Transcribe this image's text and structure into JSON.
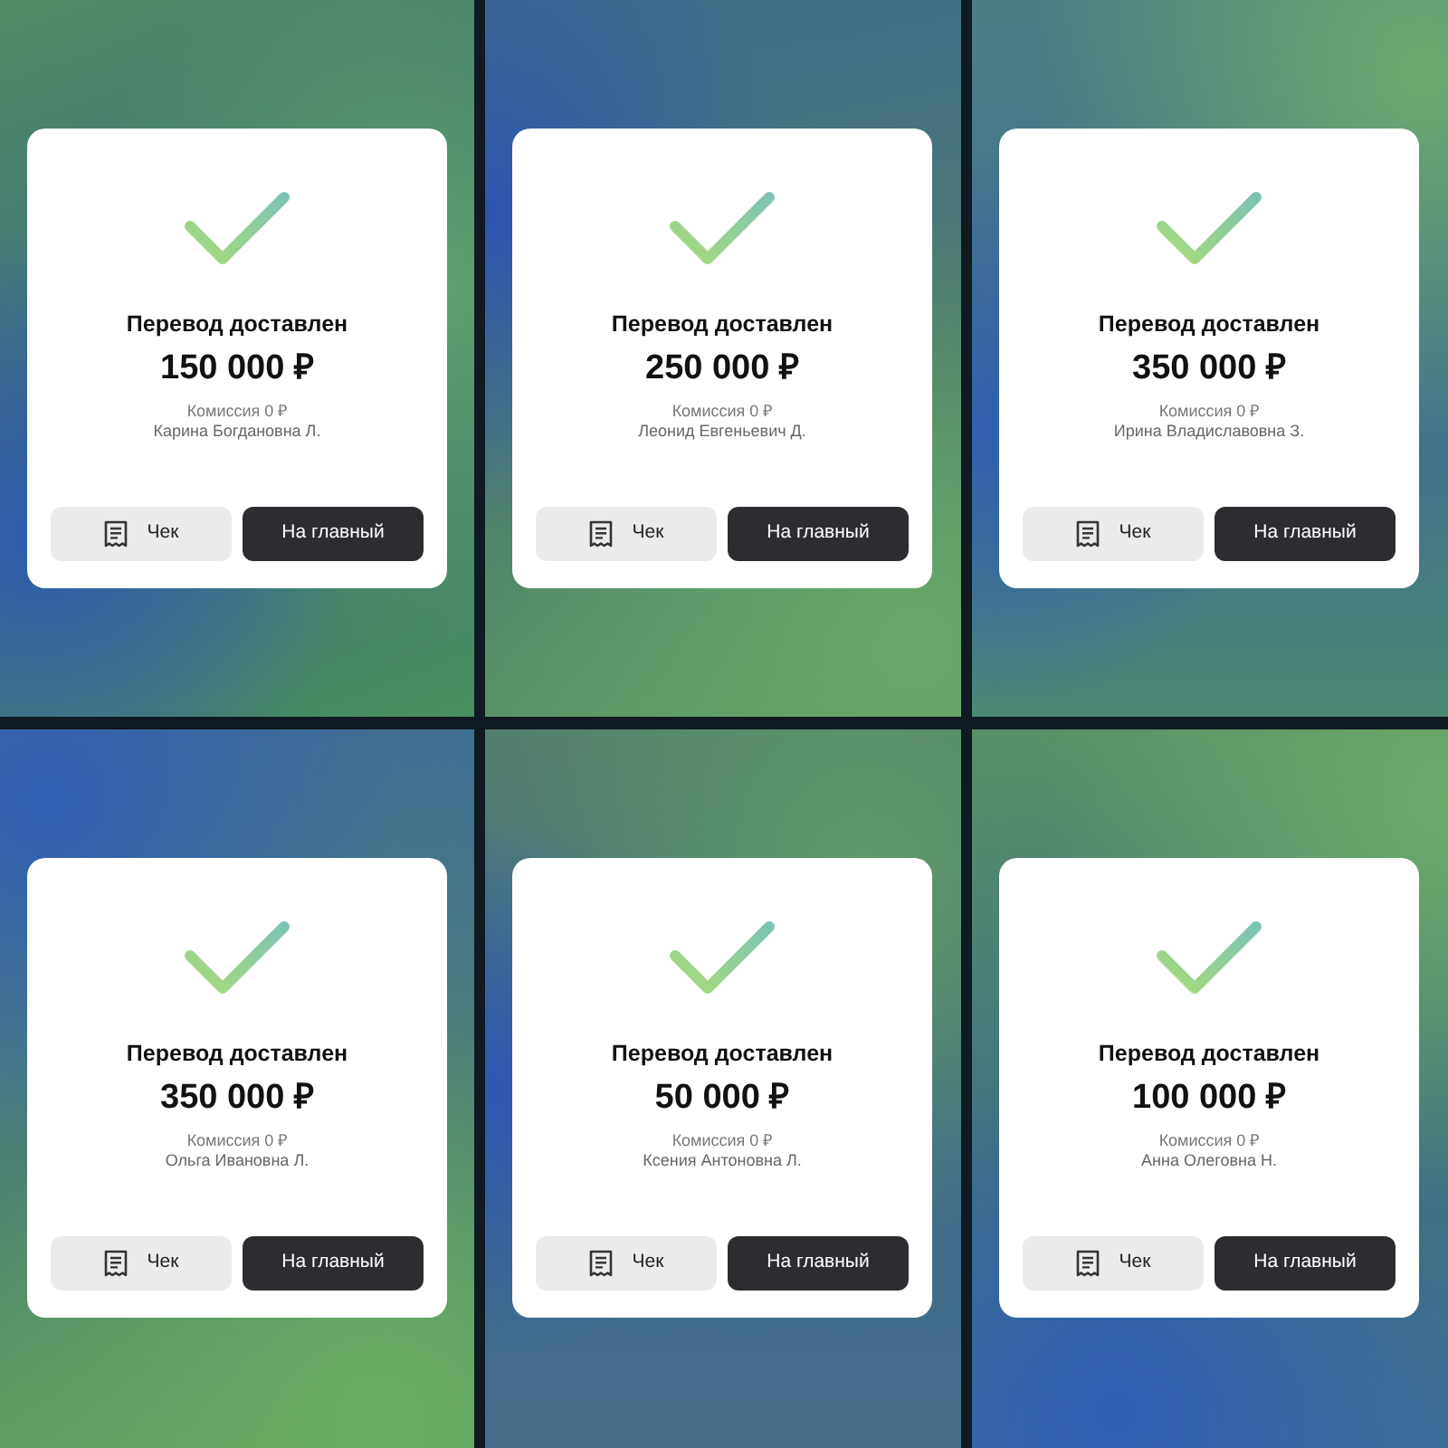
{
  "screens": [
    {
      "title": "Перевод доставлен",
      "amount": "150 000 ₽",
      "commission": "Комиссия 0 ₽",
      "recipient": "Карина Богдановна Л.",
      "receipt_button": "Чек",
      "home_button": "На главный"
    },
    {
      "title": "Перевод доставлен",
      "amount": "250 000 ₽",
      "commission": "Комиссия 0 ₽",
      "recipient": "Леонид Евгеньевич Д.",
      "receipt_button": "Чек",
      "home_button": "На главный"
    },
    {
      "title": "Перевод доставлен",
      "amount": "350 000 ₽",
      "commission": "Комиссия 0 ₽",
      "recipient": "Ирина Владиславовна З.",
      "receipt_button": "Чек",
      "home_button": "На главный"
    },
    {
      "title": "Перевод доставлен",
      "amount": "350 000 ₽",
      "commission": "Комиссия 0 ₽",
      "recipient": "Ольга Ивановна Л.",
      "receipt_button": "Чек",
      "home_button": "На главный"
    },
    {
      "title": "Перевод доставлен",
      "amount": "50 000 ₽",
      "commission": "Комиссия 0 ₽",
      "recipient": "Ксения Антоновна Л.",
      "receipt_button": "Чек",
      "home_button": "На главный"
    },
    {
      "title": "Перевод доставлен",
      "amount": "100 000 ₽",
      "commission": "Комиссия 0 ₽",
      "recipient": "Анна Олеговна Н.",
      "receipt_button": "Чек",
      "home_button": "На главный"
    }
  ]
}
